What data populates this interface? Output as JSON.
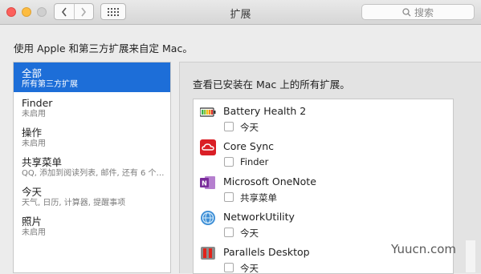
{
  "window": {
    "title": "扩展"
  },
  "toolbar": {
    "search_placeholder": "搜索"
  },
  "headline": "使用 Apple 和第三方扩展来自定 Mac。",
  "sidebar": {
    "items": [
      {
        "title": "全部",
        "subtitle": "所有第三方扩展",
        "selected": true
      },
      {
        "title": "Finder",
        "subtitle": "未启用"
      },
      {
        "title": "操作",
        "subtitle": "未启用"
      },
      {
        "title": "共享菜单",
        "subtitle": "QQ, 添加到阅读列表, 邮件, 还有 6 个…"
      },
      {
        "title": "今天",
        "subtitle": "天气, 日历, 计算器, 提醒事项"
      },
      {
        "title": "照片",
        "subtitle": "未启用"
      }
    ]
  },
  "main": {
    "heading": "查看已安装在 Mac 上的所有扩展。",
    "extensions": [
      {
        "name": "Battery Health 2",
        "option": "今天",
        "icon": "battery-icon"
      },
      {
        "name": "Core Sync",
        "option": "Finder",
        "icon": "creative-cloud-icon"
      },
      {
        "name": "Microsoft OneNote",
        "option": "共享菜单",
        "icon": "onenote-icon"
      },
      {
        "name": "NetworkUtility",
        "option": "今天",
        "icon": "network-utility-icon"
      },
      {
        "name": "Parallels Desktop",
        "option": "今天",
        "icon": "parallels-icon"
      }
    ]
  },
  "watermark": "Yuucn.com",
  "colors": {
    "selection": "#1d6ed8",
    "background": "#ececec"
  }
}
